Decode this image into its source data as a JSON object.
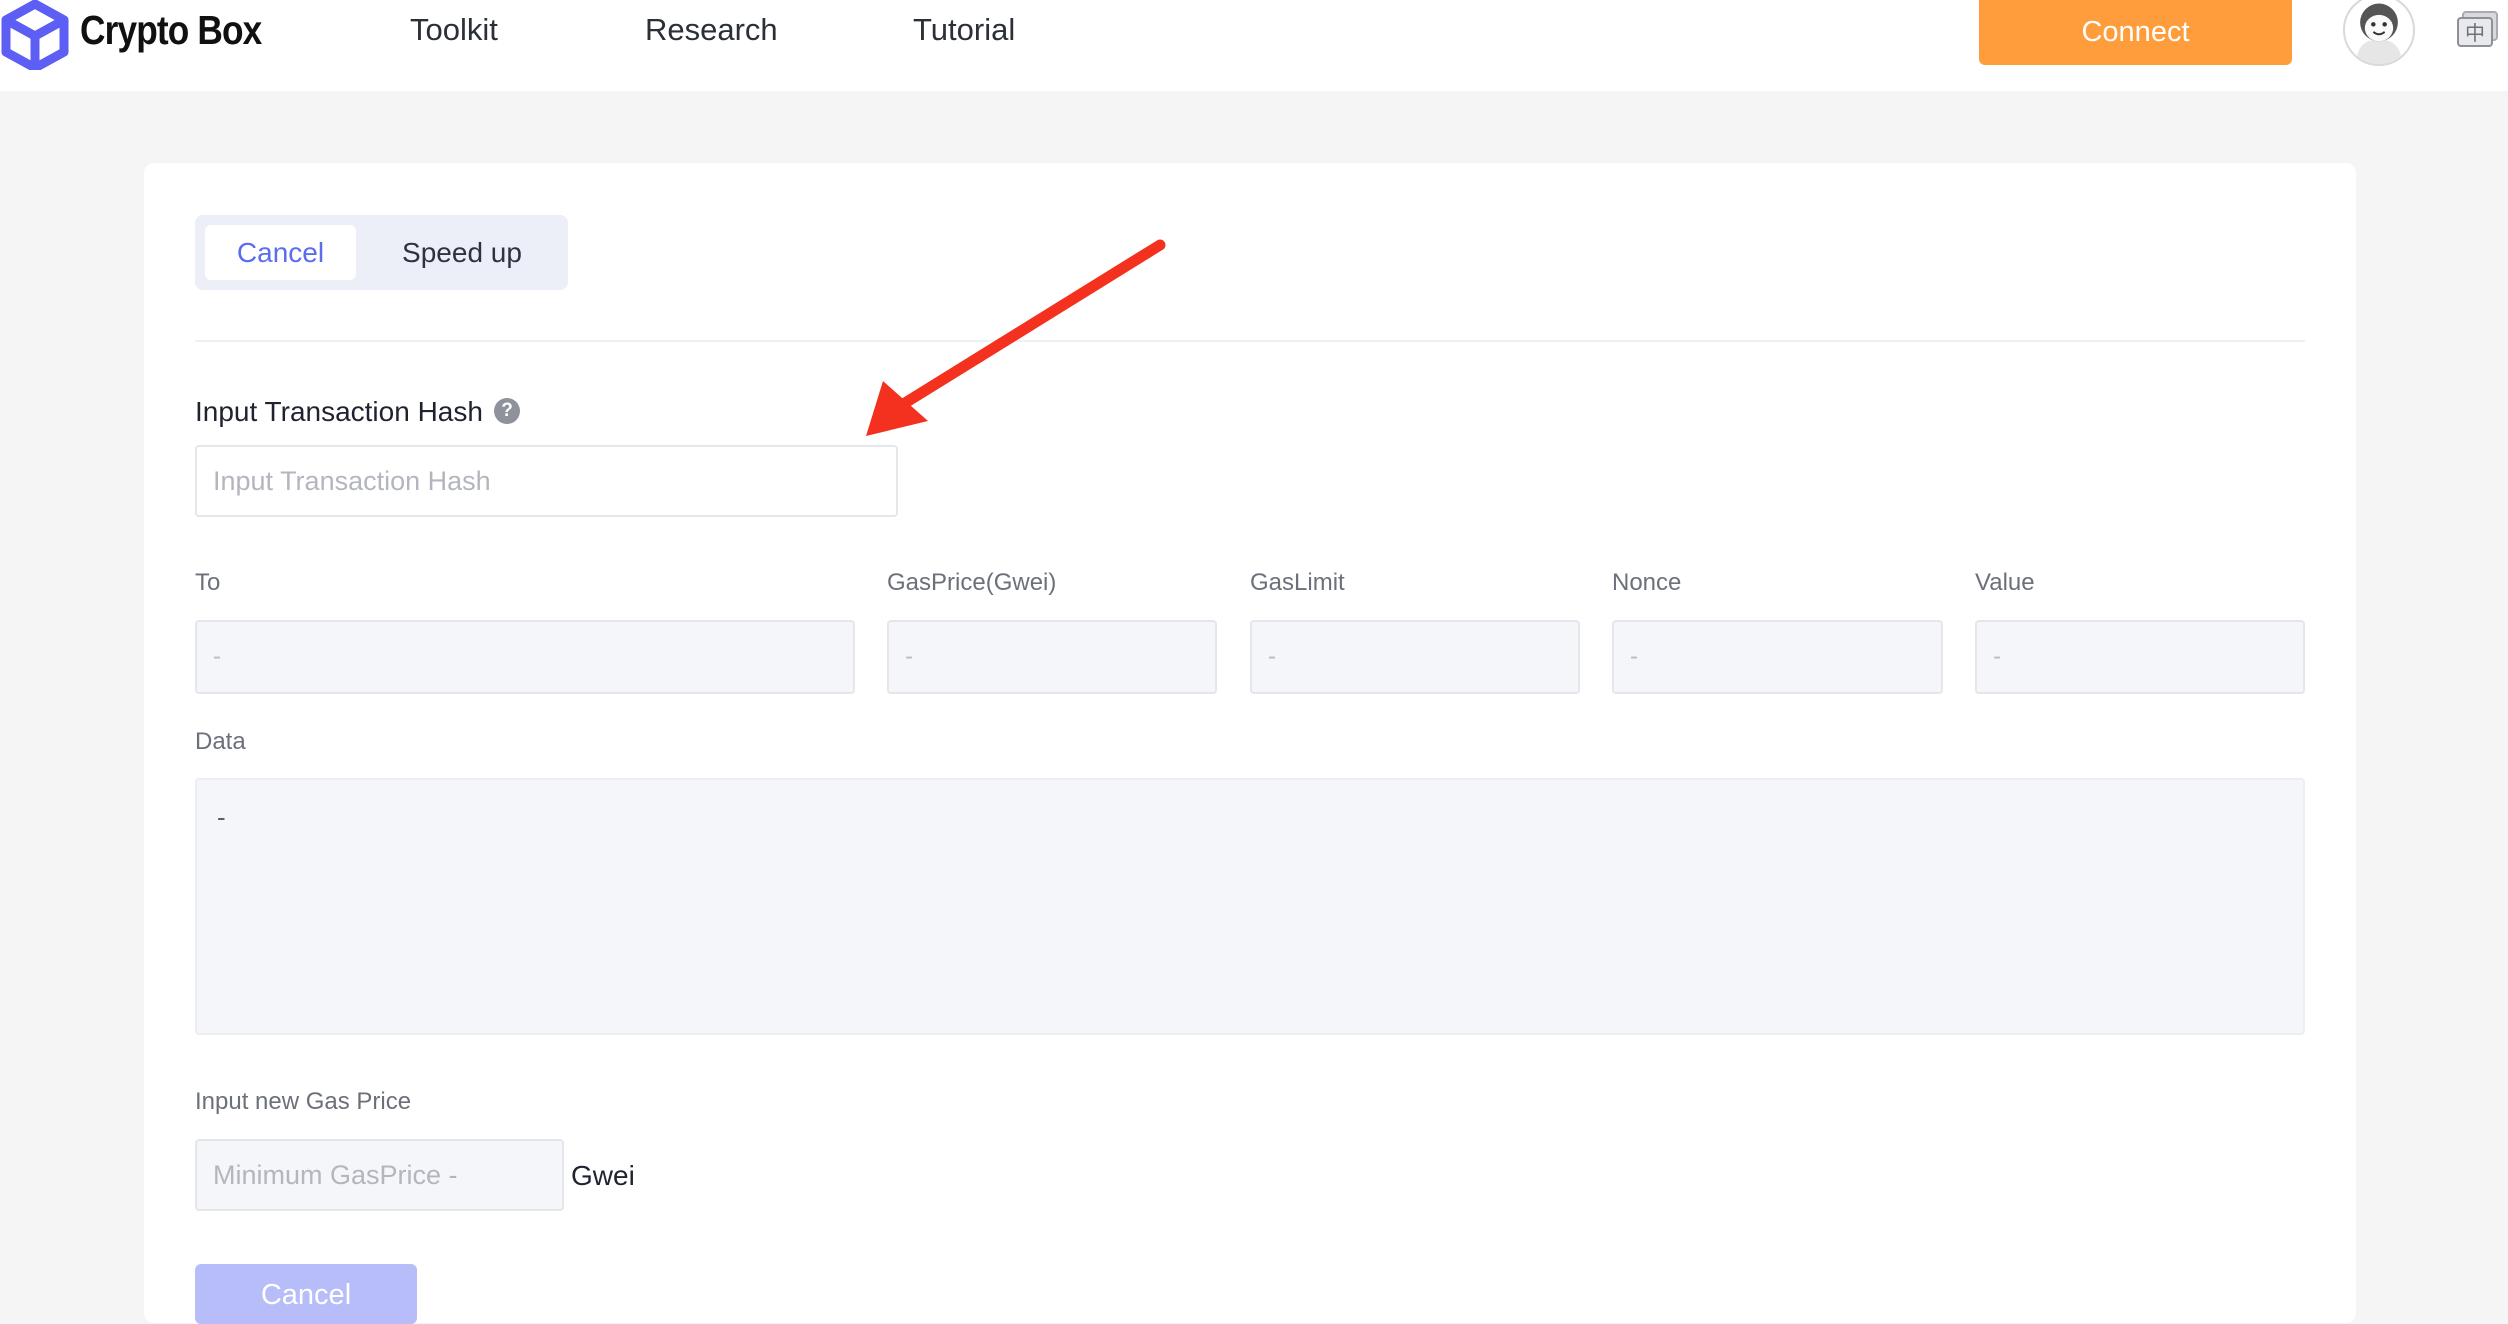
{
  "header": {
    "brand": "Crypto Box",
    "nav": [
      "Toolkit",
      "Research",
      "Tutorial"
    ],
    "connect_label": "Connect",
    "logo_icon": "cube-logo-icon",
    "avatar_icon": "user-avatar-icon",
    "lang_icon": "language-switch-icon",
    "lang_glyph": "中",
    "accent": "#ff9c3b"
  },
  "tabs": {
    "cancel_label": "Cancel",
    "speedup_label": "Speed up",
    "active": "Cancel",
    "active_color": "#5a6cf0"
  },
  "hash": {
    "label": "Input Transaction Hash",
    "help_icon": "question-circle-icon",
    "help_glyph": "?",
    "placeholder": "Input Transaction Hash",
    "value": ""
  },
  "fields": {
    "to_label": "To",
    "to_value": "-",
    "gasprice_label": "GasPrice(Gwei)",
    "gasprice_value": "-",
    "gaslimit_label": "GasLimit",
    "gaslimit_value": "-",
    "nonce_label": "Nonce",
    "nonce_value": "-",
    "value_label": "Value",
    "value_value": "-",
    "data_label": "Data",
    "data_value": "-"
  },
  "gas": {
    "label": "Input new Gas Price",
    "placeholder": "Minimum GasPrice -",
    "unit": "Gwei"
  },
  "submit_label": "Cancel",
  "annotation": {
    "arrow_icon": "red-arrow-annotation",
    "color": "#f4311f"
  }
}
